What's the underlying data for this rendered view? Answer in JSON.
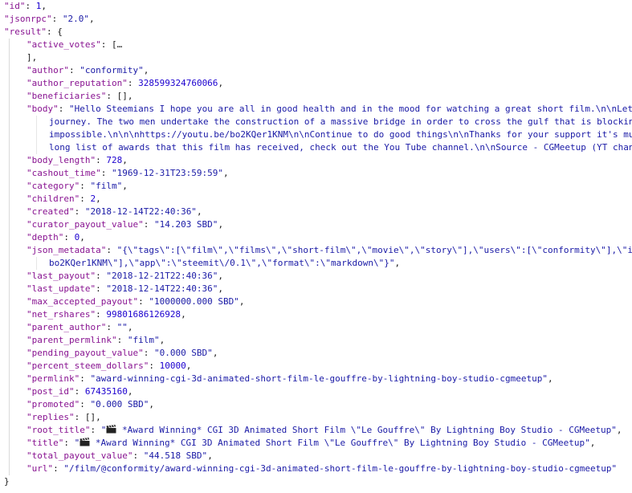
{
  "json_lines": [
    {
      "key": "\"id\"",
      "sep": ": ",
      "value": "1",
      "vtype": "n",
      "tail": ","
    },
    {
      "key": "\"jsonrpc\"",
      "sep": ": ",
      "value": "\"2.0\"",
      "vtype": "s",
      "tail": ","
    },
    {
      "key": "\"result\"",
      "sep": ": ",
      "value": "{",
      "vtype": "p",
      "tail": ""
    },
    {
      "key": "\"active_votes\"",
      "sep": ": ",
      "value": "[…",
      "vtype": "p",
      "tail": ""
    },
    {
      "key": "",
      "sep": "",
      "value": "],",
      "vtype": "p",
      "tail": ""
    },
    {
      "key": "\"author\"",
      "sep": ": ",
      "value": "\"conformity\"",
      "vtype": "s",
      "tail": ","
    },
    {
      "key": "\"author_reputation\"",
      "sep": ": ",
      "value": "328599324760066",
      "vtype": "n",
      "tail": ","
    },
    {
      "key": "\"beneficiaries\"",
      "sep": ": ",
      "value": "[]",
      "vtype": "p",
      "tail": ","
    },
    {
      "key": "\"body\"",
      "sep": ": ",
      "value": "\"Hello Steemians I hope you are all in good health and in the mood for watching a great short film.\\n\\nLet",
      "vtype": "s",
      "tail": ""
    },
    {
      "key": "",
      "sep": "",
      "value": "journey. The two men undertake the construction of a massive bridge in order to cross the gulf that is blocking",
      "vtype": "s",
      "tail": ""
    },
    {
      "key": "",
      "sep": "",
      "value": "impossible.\\n\\n\\nhttps://youtu.be/bo2KQer1KNM\\n\\nContinue to do good things\\n\\nThanks for your support it's muc",
      "vtype": "s",
      "tail": ""
    },
    {
      "key": "",
      "sep": "",
      "value": "long list of awards that this film has received, check out the You Tube channel.\\n\\nSource - CGMeetup (YT chann",
      "vtype": "s",
      "tail": ""
    },
    {
      "key": "\"body_length\"",
      "sep": ": ",
      "value": "728",
      "vtype": "n",
      "tail": ","
    },
    {
      "key": "\"cashout_time\"",
      "sep": ": ",
      "value": "\"1969-12-31T23:59:59\"",
      "vtype": "s",
      "tail": ","
    },
    {
      "key": "\"category\"",
      "sep": ": ",
      "value": "\"film\"",
      "vtype": "s",
      "tail": ","
    },
    {
      "key": "\"children\"",
      "sep": ": ",
      "value": "2",
      "vtype": "n",
      "tail": ","
    },
    {
      "key": "\"created\"",
      "sep": ": ",
      "value": "\"2018-12-14T22:40:36\"",
      "vtype": "s",
      "tail": ","
    },
    {
      "key": "\"curator_payout_value\"",
      "sep": ": ",
      "value": "\"14.203 SBD\"",
      "vtype": "s",
      "tail": ","
    },
    {
      "key": "\"depth\"",
      "sep": ": ",
      "value": "0",
      "vtype": "n",
      "tail": ","
    },
    {
      "key": "\"json_metadata\"",
      "sep": ": ",
      "value": "\"{\\\"tags\\\":[\\\"film\\\",\\\"films\\\",\\\"short-film\\\",\\\"movie\\\",\\\"story\\\"],\\\"users\\\":[\\\"conformity\\\"],\\\"im",
      "vtype": "s",
      "tail": ""
    },
    {
      "key": "",
      "sep": "",
      "value": "bo2KQer1KNM\\\"],\\\"app\\\":\\\"steemit\\/0.1\\\",\\\"format\\\":\\\"markdown\\\"}\"",
      "vtype": "s",
      "tail": ","
    },
    {
      "key": "\"last_payout\"",
      "sep": ": ",
      "value": "\"2018-12-21T22:40:36\"",
      "vtype": "s",
      "tail": ","
    },
    {
      "key": "\"last_update\"",
      "sep": ": ",
      "value": "\"2018-12-14T22:40:36\"",
      "vtype": "s",
      "tail": ","
    },
    {
      "key": "\"max_accepted_payout\"",
      "sep": ": ",
      "value": "\"1000000.000 SBD\"",
      "vtype": "s",
      "tail": ","
    },
    {
      "key": "\"net_rshares\"",
      "sep": ": ",
      "value": "99801686126928",
      "vtype": "n",
      "tail": ","
    },
    {
      "key": "\"parent_author\"",
      "sep": ": ",
      "value": "\"\"",
      "vtype": "s",
      "tail": ","
    },
    {
      "key": "\"parent_permlink\"",
      "sep": ": ",
      "value": "\"film\"",
      "vtype": "s",
      "tail": ","
    },
    {
      "key": "\"pending_payout_value\"",
      "sep": ": ",
      "value": "\"0.000 SBD\"",
      "vtype": "s",
      "tail": ","
    },
    {
      "key": "\"percent_steem_dollars\"",
      "sep": ": ",
      "value": "10000",
      "vtype": "n",
      "tail": ","
    },
    {
      "key": "\"permlink\"",
      "sep": ": ",
      "value": "\"award-winning-cgi-3d-animated-short-film-le-gouffre-by-lightning-boy-studio-cgmeetup\"",
      "vtype": "s",
      "tail": ","
    },
    {
      "key": "\"post_id\"",
      "sep": ": ",
      "value": "67435160",
      "vtype": "n",
      "tail": ","
    },
    {
      "key": "\"promoted\"",
      "sep": ": ",
      "value": "\"0.000 SBD\"",
      "vtype": "s",
      "tail": ","
    },
    {
      "key": "\"replies\"",
      "sep": ": ",
      "value": "[]",
      "vtype": "p",
      "tail": ","
    },
    {
      "key": "\"root_title\"",
      "sep": ": ",
      "value": "\"🎬 *Award Winning* CGI 3D Animated Short Film \\\"Le Gouffre\\\" By Lightning Boy Studio - CGMeetup\"",
      "vtype": "s",
      "tail": ","
    },
    {
      "key": "\"title\"",
      "sep": ": ",
      "value": "\"🎬 *Award Winning* CGI 3D Animated Short Film \\\"Le Gouffre\\\" By Lightning Boy Studio - CGMeetup\"",
      "vtype": "s",
      "tail": ","
    },
    {
      "key": "\"total_payout_value\"",
      "sep": ": ",
      "value": "\"44.518 SBD\"",
      "vtype": "s",
      "tail": ","
    },
    {
      "key": "\"url\"",
      "sep": ": ",
      "value": "\"/film/@conformity/award-winning-cgi-3d-animated-short-film-le-gouffre-by-lightning-boy-studio-cgmeetup\"",
      "vtype": "s",
      "tail": ""
    },
    {
      "key": "",
      "sep": "",
      "value": "}",
      "vtype": "p",
      "tail": ""
    }
  ]
}
